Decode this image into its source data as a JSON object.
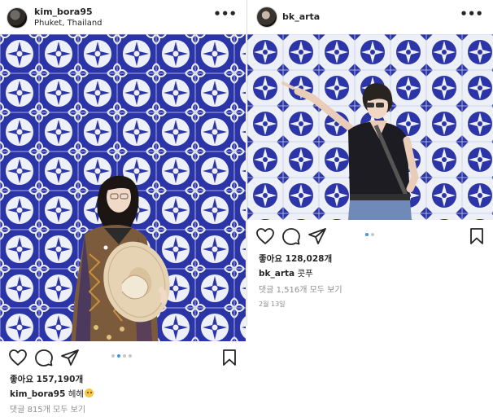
{
  "posts": [
    {
      "username": "kim_bora95",
      "location": "Phuket, Thailand",
      "more_icon": "more-horizontal-icon",
      "more_glyph": "•••",
      "likes": "좋아요 157,190개",
      "caption_user": "kim_bora95",
      "caption_text": "헤헤",
      "comments_link": "댓글 815개 모두 보기",
      "carousel": {
        "count": 4,
        "active_index": 1
      }
    },
    {
      "username": "bk_arta",
      "more_icon": "more-horizontal-icon",
      "more_glyph": "•••",
      "likes": "좋아요 128,028개",
      "caption_user": "bk_arta",
      "caption_text": "콧푸",
      "comments_link": "댓글 1,516개 모두 보기",
      "date": "2월 13일",
      "carousel": {
        "count": 2,
        "active_index": 0
      }
    }
  ],
  "icons": [
    "heart-icon",
    "comment-icon",
    "share-icon",
    "bookmark-icon"
  ],
  "colors": {
    "tile_blue": "#2b35a8",
    "tile_white": "#eef0f8",
    "link_blue": "#3897f0",
    "muted_text": "#8e8e8e"
  }
}
